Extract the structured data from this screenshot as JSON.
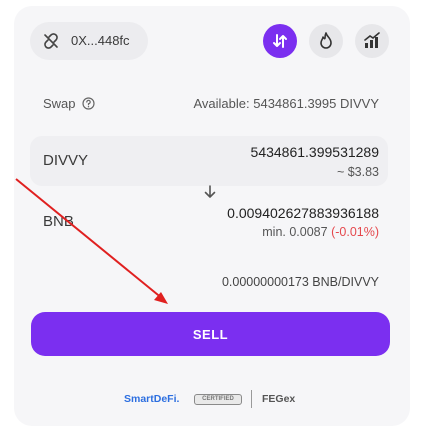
{
  "wallet": {
    "address": "0X...448fc",
    "icon": "link-off-icon"
  },
  "header_buttons": [
    {
      "name": "swap-mode-icon",
      "active": true
    },
    {
      "name": "flame-icon",
      "active": false
    },
    {
      "name": "chart-icon",
      "active": false
    }
  ],
  "swap": {
    "label": "Swap",
    "help_icon": "question-circle-icon",
    "available": "Available: 5434861.3995 DIVVY"
  },
  "from_token": {
    "symbol": "DIVVY",
    "amount": "5434861.399531289",
    "usd_value": "~ $3.83"
  },
  "to_token": {
    "symbol": "BNB",
    "amount": "0.009402627883936188",
    "min_label": "min. 0.0087",
    "slippage": "(-0.01%)"
  },
  "rate": "0.00000000173 BNB/DIVVY",
  "sell_button": "SELL",
  "footer": {
    "brand": "SmartDeFi.",
    "badge": "CERTIFIED",
    "partner": "FEGex"
  },
  "colors": {
    "accent": "#7b2ff0",
    "annotation_arrow": "#e02020",
    "negative": "#e5484d"
  }
}
